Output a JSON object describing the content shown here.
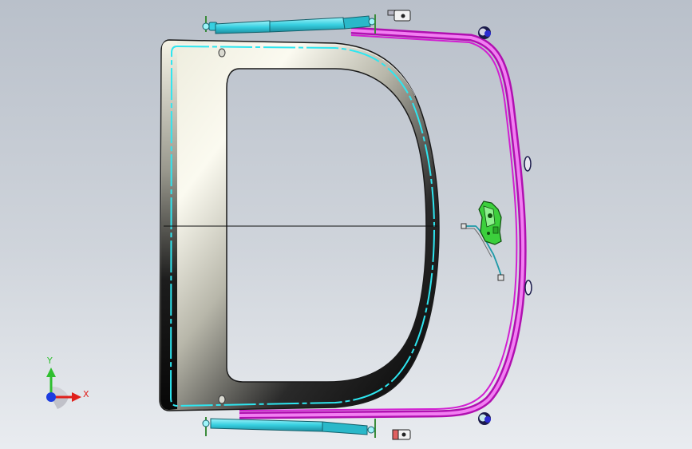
{
  "viewport": {
    "background_top": "#b9c0ca",
    "background_bottom": "#e9ecf0",
    "background_mid": "#cfd4db"
  },
  "colors": {
    "hatch_frame": "#d21fd2",
    "hatch_frame_light": "#f08cf0",
    "seal_outline": "#2ee6f0",
    "strut_body": "#3fd6e6",
    "strut_dark": "#1a8fa0",
    "latch_green": "#3ccf3c",
    "glass_light": "#f3f2e4",
    "glass_dark": "#0d0d0d",
    "edge": "#1a1a1a"
  },
  "model": {
    "parts": [
      "tailgate-glass-panel",
      "window-seal",
      "hatch-frame",
      "gas-strut-top",
      "gas-strut-bottom",
      "latch-assembly",
      "hinge-top",
      "hinge-bottom",
      "bracket-top",
      "bracket-bottom"
    ]
  },
  "triad": {
    "x_label": "X",
    "y_label": "Y",
    "x_color": "#e0201c",
    "y_color": "#2fbf2f",
    "z_color": "#1c3ce0"
  }
}
